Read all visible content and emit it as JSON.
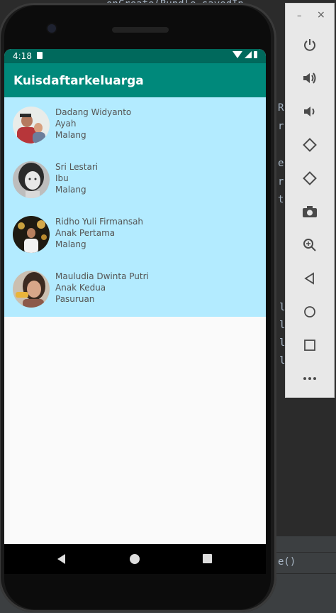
{
  "ide": {
    "code_top": "onCreate(Bundle savedIn",
    "code_right_1": "R",
    "code_right_2": "r",
    "code_right_3": "e",
    "code_right_4": "r",
    "code_right_5": "t",
    "code_bottom_lines": [
      "l",
      "l",
      "l",
      "l"
    ],
    "bottom_text": "e()"
  },
  "status_bar": {
    "time": "4:18"
  },
  "app": {
    "title": "Kuisdaftarkeluarga"
  },
  "members": [
    {
      "name": "Dadang Widyanto",
      "role": "Ayah",
      "city": "Malang"
    },
    {
      "name": "Sri Lestari",
      "role": "Ibu",
      "city": "Malang"
    },
    {
      "name": "Ridho Yuli Firmansah",
      "role": "Anak Pertama",
      "city": "Malang"
    },
    {
      "name": "Mauludia Dwinta Putri",
      "role": "Anak Kedua",
      "city": "Pasuruan"
    }
  ],
  "colors": {
    "status_bar": "#00695c",
    "app_bar": "#00897b",
    "list_bg": "#b3ebff"
  },
  "emulator": {
    "minimize": "–",
    "close": "×",
    "buttons": [
      "power-icon",
      "volume-up-icon",
      "volume-down-icon",
      "rotate-left-icon",
      "rotate-right-icon",
      "camera-icon",
      "zoom-icon",
      "back-icon",
      "home-icon",
      "overview-icon",
      "more-icon"
    ]
  }
}
